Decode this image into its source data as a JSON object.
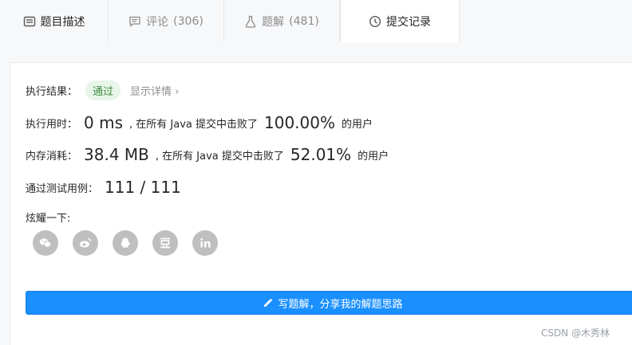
{
  "tabs": [
    {
      "label": "题目描述",
      "count": "",
      "icon": "description-icon"
    },
    {
      "label": "评论",
      "count": "(306)",
      "icon": "comment-icon"
    },
    {
      "label": "题解",
      "count": "(481)",
      "icon": "flask-icon"
    },
    {
      "label": "提交记录",
      "count": "",
      "icon": "clock-icon"
    }
  ],
  "result": {
    "label": "执行结果：",
    "status": "通过",
    "detail_link": "显示详情",
    "detail_chevron": "›"
  },
  "runtime": {
    "label": "执行用时：",
    "value": "0 ms",
    "text_before": ", 在所有 Java 提交中击败了",
    "percent": "100.00%",
    "text_after": "的用户"
  },
  "memory": {
    "label": "内存消耗：",
    "value": "38.4 MB",
    "text_before": ", 在所有 Java 提交中击败了",
    "percent": "52.01%",
    "text_after": "的用户"
  },
  "testcases": {
    "label": "通过测试用例：",
    "value": "111 / 111"
  },
  "share": {
    "label": "炫耀一下:",
    "icons": [
      "wechat-icon",
      "weibo-icon",
      "qq-icon",
      "douban-icon",
      "linkedin-icon"
    ]
  },
  "write_button": {
    "label": "写题解，分享我的解题思路",
    "icon": "pencil-icon"
  },
  "watermark": "CSDN @木秀林",
  "colors": {
    "accent": "#1a90ff",
    "success_bg": "#e8f5e9",
    "success_text": "#3f8a3f",
    "share_icon_bg": "#bfbfbf"
  }
}
